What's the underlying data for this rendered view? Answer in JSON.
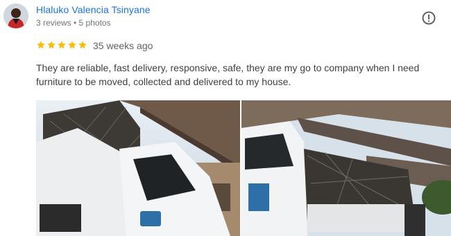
{
  "reviewer": {
    "name": "Hlaluko Valencia Tsinyane",
    "meta": "3 reviews • 5 photos",
    "avatar_icon": "person-avatar"
  },
  "review": {
    "rating": 5,
    "rating_max": 5,
    "time_ago": "35 weeks ago",
    "text": "They are reliable, fast delivery, responsive, safe, they are my go to company when I need furniture to be moved, collected and delivered to my house.",
    "star_color": "#fbbc04"
  },
  "actions": {
    "more_icon": "report-exclamation-icon"
  },
  "photos": [
    {
      "icon": "truck-photo"
    },
    {
      "icon": "truck-photo"
    }
  ]
}
